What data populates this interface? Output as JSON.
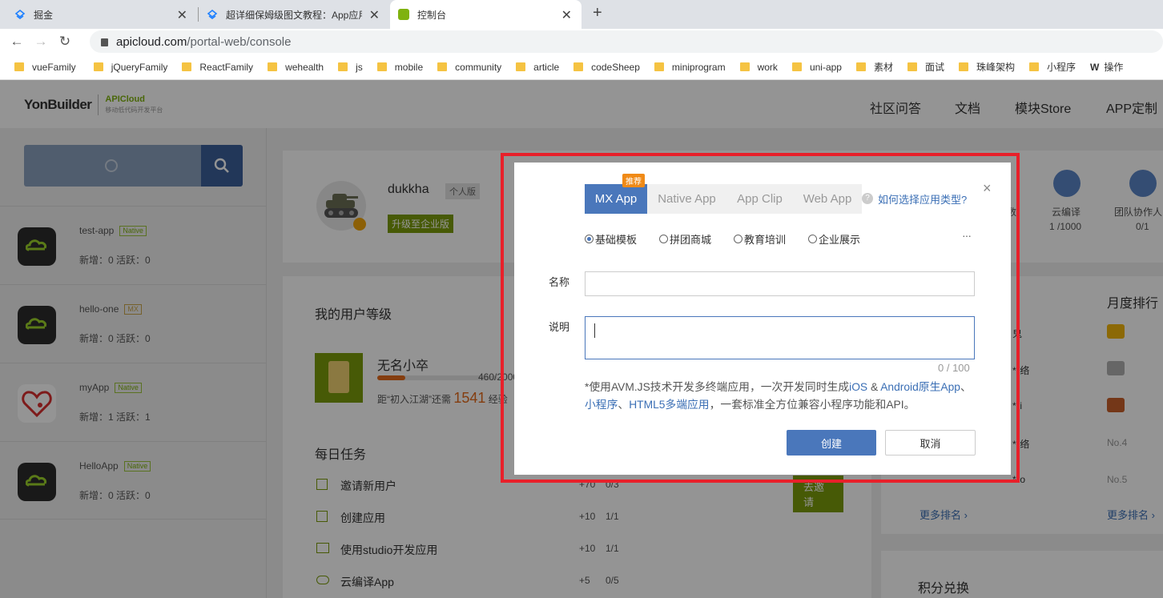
{
  "browser": {
    "tabs": [
      {
        "title": "掘金"
      },
      {
        "title": "超详细保姆级图文教程：App应用"
      },
      {
        "title": "控制台"
      }
    ],
    "new_tab": "+",
    "url_host": "apicloud.com",
    "url_path": "/portal-web/console",
    "bookmarks": [
      "vueFamily",
      "jQueryFamily",
      "ReactFamily",
      "wehealth",
      "js",
      "mobile",
      "community",
      "article",
      "codeSheep",
      "miniprogram",
      "work",
      "uni-app",
      "素材",
      "面试",
      "珠峰架构",
      "小程序",
      "操作"
    ]
  },
  "header": {
    "brand": "YonBuilder",
    "brand_sub": "APICloud",
    "brand_tagline": "移动低代码开发平台",
    "nav": [
      "社区问答",
      "文档",
      "模块Store",
      "APP定制"
    ]
  },
  "sidebar": {
    "apps": [
      {
        "name": "test-app",
        "badge": "Native",
        "stats": "新增：0  活跃：0"
      },
      {
        "name": "hello-one",
        "badge": "MX",
        "stats": "新增：0  活跃：0"
      },
      {
        "name": "myApp",
        "badge": "Native",
        "stats": "新增：1  活跃：1"
      },
      {
        "name": "HelloApp",
        "badge": "Native",
        "stats": "新增：0  活跃：0"
      }
    ]
  },
  "profile": {
    "username": "dukkha",
    "edition": "个人版",
    "upgrade": "升级至企业版",
    "stats": [
      {
        "label": "数",
        "value": ""
      },
      {
        "label": "云编译",
        "value": "1 /1000"
      },
      {
        "label": "团队协作人",
        "value": "0/1"
      }
    ]
  },
  "level": {
    "title": "我的用户等级",
    "rank_name": "无名小卒",
    "progress": "460/2000",
    "progress_fraction": 0.23,
    "hint": "距“初入江湖”还需",
    "need": "1541",
    "suffix": "经验"
  },
  "tasks": {
    "title": "每日任务",
    "items": [
      {
        "name": "邀请新用户",
        "reward": "+70",
        "count": "0/3"
      },
      {
        "name": "创建应用",
        "reward": "+10",
        "count": "1/1"
      },
      {
        "name": "使用studio开发应用",
        "reward": "+10",
        "count": "1/1"
      },
      {
        "name": "云编译App",
        "reward": "+5",
        "count": "0/5"
      }
    ],
    "invite_button": "去邀请"
  },
  "ranking": {
    "title": "月度排行",
    "users": [
      "鬼",
      "**络",
      "**i",
      "**络",
      "**o"
    ],
    "no4": "No.4",
    "no5": "No.5",
    "more": "更多排名 ›"
  },
  "exchange": {
    "title": "积分兑换"
  },
  "modal": {
    "tabs": [
      "MX App",
      "Native App",
      "App Clip",
      "Web App"
    ],
    "recommend": "推荐",
    "help": "如何选择应用类型?",
    "templates": [
      "基础模板",
      "拼团商城",
      "教育培训",
      "企业展示"
    ],
    "more": "···",
    "name_label": "名称",
    "desc_label": "说明",
    "counter": "0 / 100",
    "note_1": "*使用AVM.JS技术开发多终端应用，一次开发同时生成",
    "note_links_1": "iOS",
    "note_amp": " & ",
    "note_links_2": "Android原生App",
    "note_sep1": "、",
    "note_links_3": "小程序",
    "note_sep2": "、",
    "note_links_4": "HTML5多端应用",
    "note_2": "，一套标准全方位兼容小程序功能和API。",
    "create": "创建",
    "cancel": "取消",
    "close": "×"
  },
  "colors": {
    "accent": "#4a77bb",
    "highlight": "#e8202a",
    "native_badge": "#7fb20f"
  }
}
